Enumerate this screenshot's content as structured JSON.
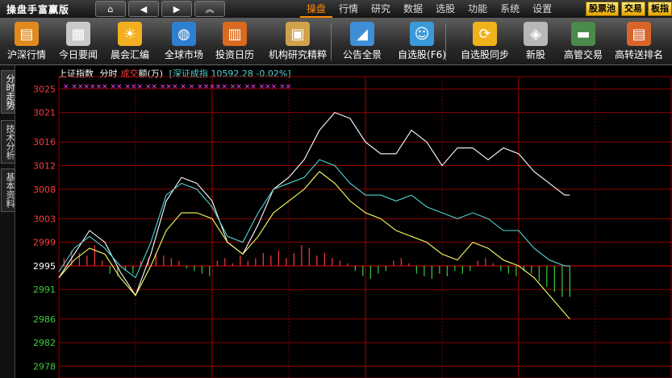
{
  "app": {
    "title": "操盘手富赢版"
  },
  "nav_buttons": [
    {
      "name": "home-icon",
      "glyph": "⌂"
    },
    {
      "name": "back-icon",
      "glyph": "◀"
    },
    {
      "name": "forward-icon",
      "glyph": "▶"
    },
    {
      "name": "collapse-up-icon",
      "glyph": "︽"
    }
  ],
  "menu": {
    "items": [
      "操盘",
      "行情",
      "研究",
      "数据",
      "选股",
      "功能",
      "系统",
      "设置"
    ],
    "active": "操盘"
  },
  "quick_buttons": [
    "股票池",
    "交易",
    "板指"
  ],
  "toolbar": {
    "items": [
      {
        "label": "沪深行情",
        "icon": "chart-icon",
        "color": "#e08a1e"
      },
      {
        "label": "今日要闻",
        "icon": "news-icon",
        "color": "#c9c9c9"
      },
      {
        "label": "晨会汇编",
        "icon": "morning-icon",
        "color": "#f2b01e"
      },
      {
        "label": "全球市场",
        "icon": "globe-icon",
        "color": "#2f7fd1"
      },
      {
        "label": "投资日历",
        "icon": "calendar-icon",
        "color": "#d96a1e"
      },
      {
        "label": "机构研究精粹",
        "icon": "clipboard-icon",
        "color": "#d1a14c"
      },
      {
        "label": "公告全景",
        "icon": "megaphone-icon",
        "color": "#3f8fd6"
      },
      {
        "label": "自选股(F6)",
        "icon": "user-stock-icon",
        "color": "#3a9ad9"
      },
      {
        "label": "自选股同步",
        "icon": "sync-icon",
        "color": "#f0b21a"
      },
      {
        "label": "新股",
        "icon": "new-stock-icon",
        "color": "#b8b8b8"
      },
      {
        "label": "高管交易",
        "icon": "exec-trade-icon",
        "color": "#4a8a4a"
      },
      {
        "label": "高转送排名",
        "icon": "ranking-icon",
        "color": "#d9642a"
      }
    ]
  },
  "side_tabs": [
    "分时走势",
    "技术分析",
    "基本资料"
  ],
  "chart_header": {
    "index_name": "上证指数",
    "mode_label": "分时",
    "vol_prefix": "成交",
    "vol_suffix": "额(万)",
    "compare_label": "[深证成指 10592.28 -0.02%]"
  },
  "colors": {
    "up": "#ff3b3b",
    "down": "#3bcc3b",
    "grid": "#8b0000",
    "price_line": "#ffffff",
    "avg_line": "#ffff66",
    "compare_line": "#4fd6d6",
    "marker": "#ff44ff"
  },
  "chart_data": {
    "type": "line",
    "y_ticks": [
      3025,
      3021,
      3016,
      3012,
      3008,
      3003,
      2999,
      2995,
      2991,
      2986,
      2982,
      2978
    ],
    "ylim": [
      2976,
      3026
    ],
    "prev_close": 2995,
    "x_minutes_total": 240,
    "series": [
      {
        "name": "上证指数",
        "x": [
          0,
          6,
          12,
          18,
          24,
          30,
          36,
          42,
          48,
          54,
          60,
          66,
          72,
          78,
          84,
          90,
          96,
          102,
          108,
          114,
          120,
          126,
          132,
          138,
          144,
          150,
          156,
          162,
          168,
          174,
          180,
          186,
          192,
          198,
          200
        ],
        "values": [
          2993,
          2997,
          3001,
          2999,
          2994,
          2990,
          2997,
          3006,
          3010,
          3009,
          3006,
          2999,
          2997,
          3002,
          3008,
          3010,
          3013,
          3018,
          3021,
          3020,
          3016,
          3014,
          3014,
          3018,
          3016,
          3012,
          3015,
          3015,
          3013,
          3015,
          3014,
          3011,
          3009,
          3007,
          3007
        ]
      },
      {
        "name": "均价",
        "x": [
          0,
          6,
          12,
          18,
          24,
          30,
          36,
          42,
          48,
          54,
          60,
          66,
          72,
          78,
          84,
          90,
          96,
          102,
          108,
          114,
          120,
          126,
          132,
          138,
          144,
          150,
          156,
          162,
          168,
          174,
          180,
          186,
          192,
          198,
          200
        ],
        "values": [
          2993,
          2996,
          2998,
          2997,
          2993,
          2990,
          2995,
          3001,
          3004,
          3004,
          3003,
          2999,
          2997,
          3000,
          3004,
          3006,
          3008,
          3011,
          3009,
          3006,
          3004,
          3003,
          3001,
          3000,
          2999,
          2997,
          2996,
          2999,
          2998,
          2996,
          2995,
          2993,
          2990,
          2987,
          2986
        ]
      },
      {
        "name": "深证成指",
        "x": [
          0,
          6,
          12,
          18,
          24,
          30,
          36,
          42,
          48,
          54,
          60,
          66,
          72,
          78,
          84,
          90,
          96,
          102,
          108,
          114,
          120,
          126,
          132,
          138,
          144,
          150,
          156,
          162,
          168,
          174,
          180,
          186,
          192,
          198,
          200
        ],
        "values": [
          2994,
          2998,
          3000,
          2998,
          2995,
          2993,
          2999,
          3007,
          3009,
          3008,
          3005,
          3000,
          2999,
          3004,
          3008,
          3009,
          3010,
          3013,
          3012,
          3009,
          3007,
          3007,
          3006,
          3007,
          3005,
          3004,
          3003,
          3004,
          3003,
          3001,
          3001,
          2998,
          2996,
          2995,
          2995
        ]
      }
    ],
    "volume_bars": {
      "x": [
        2,
        5,
        8,
        11,
        14,
        17,
        20,
        23,
        26,
        29,
        32,
        35,
        38,
        41,
        44,
        47,
        50,
        53,
        56,
        59,
        62,
        65,
        68,
        71,
        74,
        77,
        80,
        83,
        86,
        89,
        92,
        95,
        98,
        101,
        104,
        107,
        110,
        113,
        116,
        119,
        122,
        125,
        128,
        131,
        134,
        137,
        140,
        143,
        146,
        149,
        152,
        155,
        158,
        161,
        164,
        167,
        170,
        173,
        176,
        179,
        182,
        185,
        188,
        191,
        194,
        197,
        200
      ],
      "values": [
        3,
        6,
        5,
        4,
        8,
        2,
        -3,
        -4,
        -2,
        -3,
        2,
        3,
        5,
        4,
        3,
        2,
        -1,
        -2,
        -3,
        -4,
        2,
        3,
        1,
        4,
        2,
        3,
        5,
        4,
        6,
        3,
        5,
        8,
        7,
        4,
        5,
        3,
        2,
        1,
        -2,
        -4,
        -5,
        -3,
        -2,
        2,
        3,
        1,
        -3,
        -4,
        -5,
        -3,
        -4,
        -2,
        -3,
        -2,
        2,
        3,
        1,
        -2,
        -3,
        -4,
        -2,
        -3,
        -6,
        -8,
        -10,
        -12,
        -12
      ]
    },
    "event_markers": "× ×××××× ××  ××× ×× ×××  × ×  ××××× ××          ×× ××× ××"
  }
}
